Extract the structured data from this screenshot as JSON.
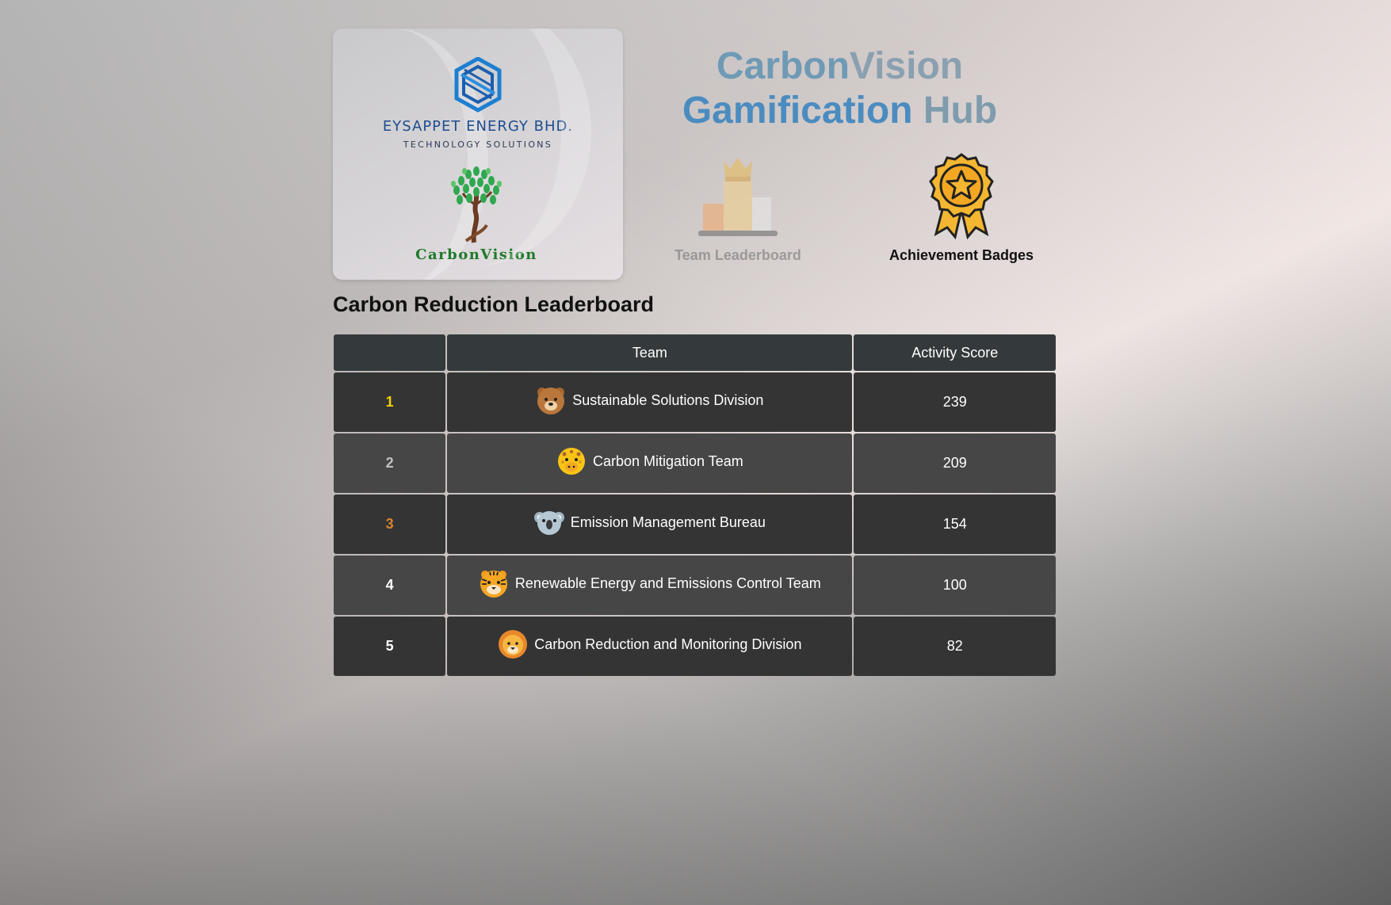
{
  "brand": {
    "company_name": "EYSAPPET ENERGY BHD.",
    "company_tagline": "TECHNOLOGY SOLUTIONS",
    "product_wordmark": "CarbonVision"
  },
  "hub": {
    "title_part1": "Carbon",
    "title_part2": "Vision",
    "title_part3": "Gamification",
    "title_part4": "Hub"
  },
  "features": {
    "leaderboard_label": "Team Leaderboard",
    "badges_label": "Achievement Badges"
  },
  "leaderboard": {
    "title": "Carbon Reduction Leaderboard",
    "columns": [
      "",
      "Team",
      "Activity Score"
    ],
    "rows": [
      {
        "rank": "1",
        "team": "Sustainable Solutions Division",
        "score": "239",
        "avatar": "bear-icon",
        "rank_color": "#f5d000"
      },
      {
        "rank": "2",
        "team": "Carbon Mitigation Team",
        "score": "209",
        "avatar": "giraffe-icon",
        "rank_color": "#c0c0c0"
      },
      {
        "rank": "3",
        "team": "Emission Management Bureau",
        "score": "154",
        "avatar": "koala-icon",
        "rank_color": "#d9822b"
      },
      {
        "rank": "4",
        "team": "Renewable Energy and Emissions Control Team",
        "score": "100",
        "avatar": "tiger-icon",
        "rank_color": "#ffffff"
      },
      {
        "rank": "5",
        "team": "Carbon Reduction and Monitoring Division",
        "score": "82",
        "avatar": "lion-icon",
        "rank_color": "#ffffff"
      }
    ]
  }
}
